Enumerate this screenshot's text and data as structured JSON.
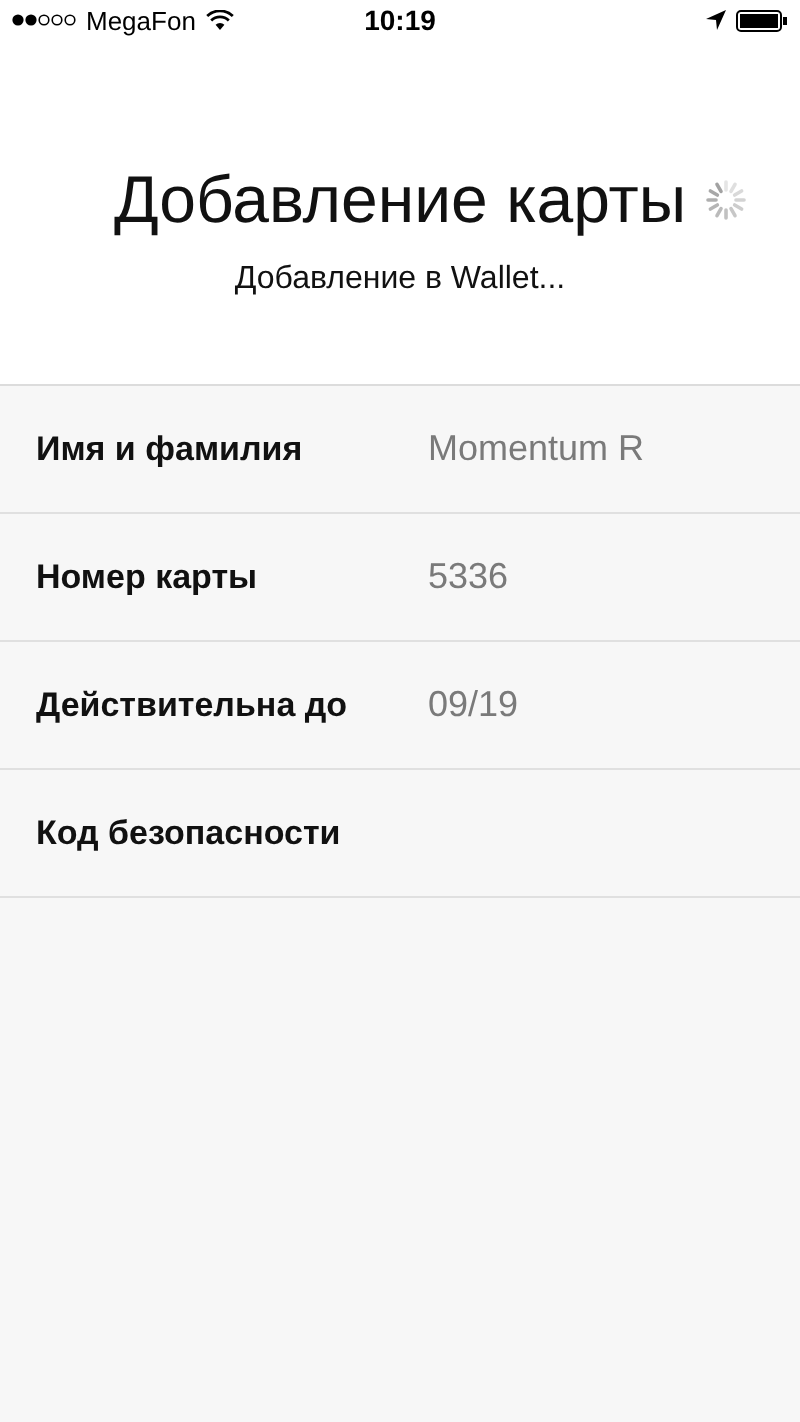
{
  "status_bar": {
    "carrier": "MegaFon",
    "time": "10:19"
  },
  "header": {
    "title": "Добавление карты",
    "subtitle": "Добавление в Wallet...",
    "loading": true
  },
  "fields": [
    {
      "label": "Имя и фамилия",
      "value": "Momentum R"
    },
    {
      "label": "Номер карты",
      "value": "5336"
    },
    {
      "label": "Действительна до",
      "value": "09/19"
    },
    {
      "label": "Код безопасности"
    }
  ]
}
